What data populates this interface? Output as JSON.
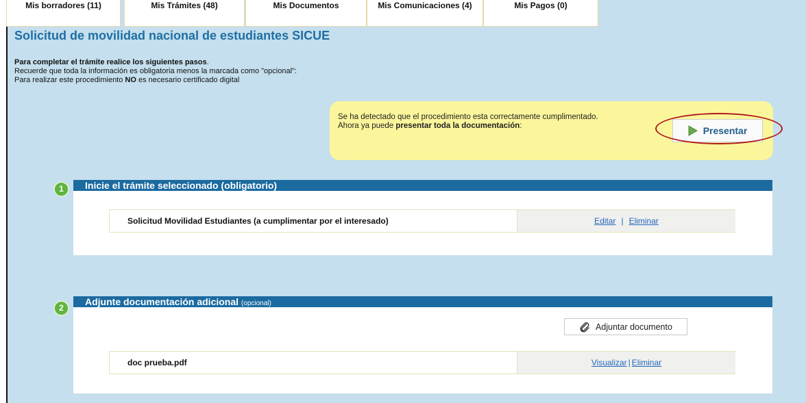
{
  "tabs": [
    {
      "label": "Mis borradores (11)"
    },
    {
      "label": "Mis Trámites (48)"
    },
    {
      "label": "Mis Documentos"
    },
    {
      "label": "Mis Comunicaciones (4)"
    },
    {
      "label": "Mis Pagos (0)"
    }
  ],
  "page": {
    "title": "Solicitud de movilidad nacional de estudiantes SICUE",
    "instr_line1": "Para completar el trámite realice los siguientes pasos",
    "instr_line2": "Recuerde que toda la información es obligatoria menos la marcada como \"opcional\":",
    "instr_line3_a": "Para realizar este procedimiento ",
    "instr_line3_b": "NO",
    "instr_line3_c": " es necesario certificado digital"
  },
  "notice": {
    "line1": "Se ha detectado que el procedimiento esta correctamente cumplimentado.",
    "line2_a": "Ahora ya puede ",
    "line2_b": "presentar toda la documentación",
    "line2_c": ":",
    "button_label": "Presentar"
  },
  "step1": {
    "number": "1",
    "title": "Inicie el trámite seleccionado (obligatorio)",
    "doc_name": "Solicitud Movilidad Estudiantes (a cumplimentar por el interesado)",
    "edit_label": "Editar",
    "separator": "|",
    "delete_label": "Eliminar"
  },
  "step2": {
    "number": "2",
    "title": "Adjunte documentación adicional",
    "title_note": "(opcional)",
    "attach_label": "Adjuntar documento",
    "doc_name": "doc prueba.pdf",
    "view_label": "Visualizar",
    "separator": "|",
    "delete_label": "Eliminar"
  },
  "icons": {
    "present": "play-arrow-icon",
    "attach": "paperclip-icon"
  },
  "colors": {
    "title": "#1f6fa3",
    "header_bar": "#1b6aa0",
    "notice_bg": "#fbf69b",
    "step_badge": "#5fb53f",
    "link": "#2266bb",
    "highlight_ring": "#b0181c"
  }
}
